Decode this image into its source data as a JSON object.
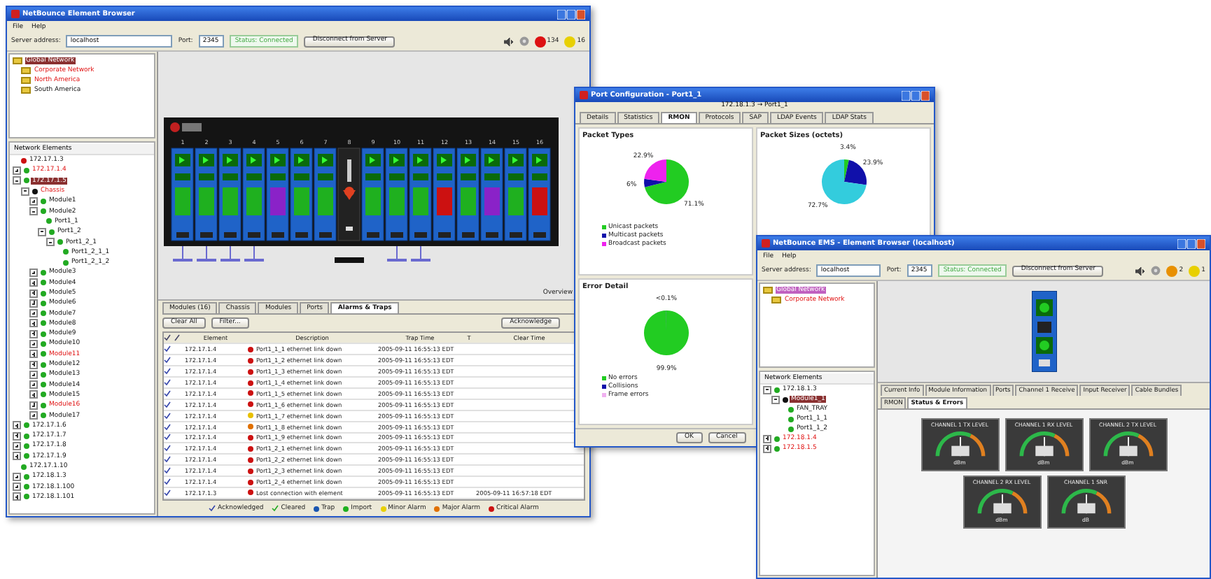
{
  "main_window": {
    "title": "NetBounce Element Browser",
    "menu": [
      "File",
      "Help"
    ],
    "server": {
      "label": "Server address:",
      "value": "localhost"
    },
    "port": {
      "label": "Port:",
      "value": "2345"
    },
    "status": "Status: Connected",
    "disconnect_button": "Disconnect from Server",
    "alarm_badges": [
      {
        "count": "134",
        "color": "#dd1111"
      },
      {
        "count": "16",
        "color": "#e8d000"
      }
    ],
    "network_tree": [
      {
        "label": "Global Network",
        "selected": true,
        "alarm": false
      },
      {
        "label": "Corporate Network",
        "selected": false,
        "alarm": true
      },
      {
        "label": "North America",
        "selected": false,
        "alarm": true
      },
      {
        "label": "South America",
        "selected": false,
        "alarm": false
      }
    ],
    "element_tree_title": "Network Elements",
    "element_tree": [
      {
        "label": "172.17.1.3",
        "color": "#cc1111",
        "alarm": false,
        "selected": false
      },
      {
        "label": "172.17.1.4",
        "color": "#22aa22",
        "alarm": true,
        "selected": false,
        "expanded": false
      },
      {
        "label": "172.17.1.5",
        "color": "#22aa22",
        "alarm": false,
        "selected": true,
        "expanded": true,
        "children": [
          {
            "label": "Chassis",
            "color": "#111111",
            "alarm": true,
            "selected": false,
            "expanded": true,
            "children": [
              {
                "label": "Module1",
                "color": "#22aa22",
                "alarm": false,
                "selected": false,
                "expanded": false
              },
              {
                "label": "Module2",
                "color": "#22aa22",
                "alarm": false,
                "selected": false,
                "expanded": true,
                "children": [
                  {
                    "label": "Port1_1",
                    "color": "#22aa22",
                    "alarm": false,
                    "selected": false
                  },
                  {
                    "label": "Port1_2",
                    "color": "#22aa22",
                    "alarm": false,
                    "selected": false,
                    "expanded": true,
                    "children": [
                      {
                        "label": "Port1_2_1",
                        "color": "#22aa22",
                        "alarm": false,
                        "selected": false,
                        "expanded": true,
                        "children": [
                          {
                            "label": "Port1_2_1_1",
                            "color": "#22aa22",
                            "alarm": false,
                            "selected": false
                          },
                          {
                            "label": "Port1_2_1_2",
                            "color": "#22aa22",
                            "alarm": false,
                            "selected": false
                          }
                        ]
                      }
                    ]
                  }
                ]
              },
              {
                "label": "Module3",
                "color": "#22aa22",
                "alarm": false,
                "selected": false,
                "expanded": false
              },
              {
                "label": "Module4",
                "color": "#22aa22",
                "alarm": false,
                "selected": false,
                "expanded": false
              },
              {
                "label": "Module5",
                "color": "#22aa22",
                "alarm": false,
                "selected": false,
                "expanded": false
              },
              {
                "label": "Module6",
                "color": "#22aa22",
                "alarm": false,
                "selected": false,
                "expanded": false
              },
              {
                "label": "Module7",
                "color": "#22aa22",
                "alarm": false,
                "selected": false,
                "expanded": false
              },
              {
                "label": "Module8",
                "color": "#22aa22",
                "alarm": false,
                "selected": false,
                "expanded": false
              },
              {
                "label": "Module9",
                "color": "#22aa22",
                "alarm": false,
                "selected": false,
                "expanded": false
              },
              {
                "label": "Module10",
                "color": "#22aa22",
                "alarm": false,
                "selected": false,
                "expanded": false
              },
              {
                "label": "Module11",
                "color": "#22aa22",
                "alarm": true,
                "selected": false,
                "expanded": false
              },
              {
                "label": "Module12",
                "color": "#22aa22",
                "alarm": false,
                "selected": false,
                "expanded": false
              },
              {
                "label": "Module13",
                "color": "#22aa22",
                "alarm": false,
                "selected": false,
                "expanded": false
              },
              {
                "label": "Module14",
                "color": "#22aa22",
                "alarm": false,
                "selected": false,
                "expanded": false
              },
              {
                "label": "Module15",
                "color": "#22aa22",
                "alarm": false,
                "selected": false,
                "expanded": false
              },
              {
                "label": "Module16",
                "color": "#22aa22",
                "alarm": true,
                "selected": false,
                "expanded": false
              },
              {
                "label": "Module17",
                "color": "#22aa22",
                "alarm": false,
                "selected": false,
                "expanded": false
              }
            ]
          }
        ]
      },
      {
        "label": "172.17.1.6",
        "color": "#22aa22",
        "alarm": false,
        "selected": false,
        "expanded": false
      },
      {
        "label": "172.17.1.7",
        "color": "#22aa22",
        "alarm": false,
        "selected": false,
        "expanded": false
      },
      {
        "label": "172.17.1.8",
        "color": "#22aa22",
        "alarm": false,
        "selected": false,
        "expanded": false
      },
      {
        "label": "172.17.1.9",
        "color": "#22aa22",
        "alarm": false,
        "selected": false,
        "expanded": false
      },
      {
        "label": "172.17.1.10",
        "color": "#22aa22",
        "alarm": false,
        "selected": false
      },
      {
        "label": "172.18.1.3",
        "color": "#22aa22",
        "alarm": false,
        "selected": false,
        "expanded": false
      },
      {
        "label": "172.18.1.100",
        "color": "#22aa22",
        "alarm": false,
        "selected": false,
        "expanded": false
      },
      {
        "label": "172.18.1.101",
        "color": "#22aa22",
        "alarm": false,
        "selected": false,
        "expanded": false
      }
    ],
    "chassis_slots": [
      {
        "number": "1",
        "kind": "module",
        "color": "#1fb01f"
      },
      {
        "number": "2",
        "kind": "module",
        "color": "#1fb01f"
      },
      {
        "number": "3",
        "kind": "module",
        "color": "#1fb01f"
      },
      {
        "number": "4",
        "kind": "module",
        "color": "#1fb01f"
      },
      {
        "number": "5",
        "kind": "module",
        "color": "#8a22c8"
      },
      {
        "number": "6",
        "kind": "module",
        "color": "#1fb01f"
      },
      {
        "number": "7",
        "kind": "module",
        "color": "#1fb01f"
      },
      {
        "number": "8",
        "kind": "controller"
      },
      {
        "number": "9",
        "kind": "module",
        "color": "#1fb01f"
      },
      {
        "number": "10",
        "kind": "module",
        "color": "#1fb01f"
      },
      {
        "number": "11",
        "kind": "module",
        "color": "#1fb01f"
      },
      {
        "number": "12",
        "kind": "module",
        "color": "#cc1111"
      },
      {
        "number": "13",
        "kind": "module",
        "color": "#1fb01f"
      },
      {
        "number": "14",
        "kind": "module",
        "color": "#8a22c8"
      },
      {
        "number": "15",
        "kind": "module",
        "color": "#1fb01f"
      },
      {
        "number": "16",
        "kind": "module",
        "color": "#cc1111"
      }
    ],
    "overview_label": "Overview",
    "bottom_tabs": [
      {
        "label": "Modules (16)",
        "selected": false
      },
      {
        "label": "Chassis",
        "selected": false
      },
      {
        "label": "Modules",
        "selected": false
      },
      {
        "label": "Ports",
        "selected": false
      },
      {
        "label": "Alarms & Traps",
        "selected": true
      }
    ],
    "alarm_buttons": [
      "Clear All",
      "Filter..."
    ],
    "acknowledge_button": "Acknowledge",
    "alarm_columns": [
      "Element",
      "Description",
      "Trap Time",
      "T",
      "Clear Time"
    ],
    "alarm_rows": [
      {
        "acknowledged": true,
        "element": "172.17.1.4",
        "color": "#cc1111",
        "description": "Port1_1_1  ethernet link down",
        "trap_time": "2005-09-11 16:55:13 EDT",
        "clear_time": ""
      },
      {
        "acknowledged": true,
        "element": "172.17.1.4",
        "color": "#cc1111",
        "description": "Port1_1_2  ethernet link down",
        "trap_time": "2005-09-11 16:55:13 EDT",
        "clear_time": ""
      },
      {
        "acknowledged": true,
        "element": "172.17.1.4",
        "color": "#cc1111",
        "description": "Port1_1_3  ethernet link down",
        "trap_time": "2005-09-11 16:55:13 EDT",
        "clear_time": ""
      },
      {
        "acknowledged": true,
        "element": "172.17.1.4",
        "color": "#cc1111",
        "description": "Port1_1_4  ethernet link down",
        "trap_time": "2005-09-11 16:55:13 EDT",
        "clear_time": ""
      },
      {
        "acknowledged": true,
        "element": "172.17.1.4",
        "color": "#cc1111",
        "description": "Port1_1_5  ethernet link down",
        "trap_time": "2005-09-11 16:55:13 EDT",
        "clear_time": ""
      },
      {
        "acknowledged": true,
        "element": "172.17.1.4",
        "color": "#cc1111",
        "description": "Port1_1_6  ethernet link down",
        "trap_time": "2005-09-11 16:55:13 EDT",
        "clear_time": ""
      },
      {
        "acknowledged": true,
        "element": "172.17.1.4",
        "color": "#e8c000",
        "description": "Port1_1_7  ethernet link down",
        "trap_time": "2005-09-11 16:55:13 EDT",
        "clear_time": ""
      },
      {
        "acknowledged": true,
        "element": "172.17.1.4",
        "color": "#e07000",
        "description": "Port1_1_8  ethernet link down",
        "trap_time": "2005-09-11 16:55:13 EDT",
        "clear_time": ""
      },
      {
        "acknowledged": true,
        "element": "172.17.1.4",
        "color": "#cc1111",
        "description": "Port1_1_9  ethernet link down",
        "trap_time": "2005-09-11 16:55:13 EDT",
        "clear_time": ""
      },
      {
        "acknowledged": true,
        "element": "172.17.1.4",
        "color": "#cc1111",
        "description": "Port1_2_1  ethernet link down",
        "trap_time": "2005-09-11 16:55:13 EDT",
        "clear_time": ""
      },
      {
        "acknowledged": true,
        "element": "172.17.1.4",
        "color": "#cc1111",
        "description": "Port1_2_2  ethernet link down",
        "trap_time": "2005-09-11 16:55:13 EDT",
        "clear_time": ""
      },
      {
        "acknowledged": true,
        "element": "172.17.1.4",
        "color": "#cc1111",
        "description": "Port1_2_3  ethernet link down",
        "trap_time": "2005-09-11 16:55:13 EDT",
        "clear_time": ""
      },
      {
        "acknowledged": true,
        "element": "172.17.1.4",
        "color": "#cc1111",
        "description": "Port1_2_4  ethernet link down",
        "trap_time": "2005-09-11 16:55:13 EDT",
        "clear_time": ""
      },
      {
        "acknowledged": true,
        "element": "172.17.1.3",
        "color": "#cc1111",
        "description": "Lost connection with element",
        "trap_time": "2005-09-11 16:55:13 EDT",
        "clear_time": "2005-09-11 16:57:18 EDT"
      }
    ],
    "legend": [
      {
        "label": "Acknowledged",
        "kind": "check"
      },
      {
        "label": "Cleared",
        "kind": "check",
        "color": "#22aa22"
      },
      {
        "label": "Trap",
        "kind": "dot",
        "color": "#1a56b0"
      },
      {
        "label": "Import",
        "kind": "dot",
        "color": "#1fb01f"
      },
      {
        "label": "Minor Alarm",
        "kind": "dot",
        "color": "#e8d000"
      },
      {
        "label": "Major Alarm",
        "kind": "dot",
        "color": "#e07000"
      },
      {
        "label": "Critical Alarm",
        "kind": "dot",
        "color": "#cc1111"
      }
    ]
  },
  "port_dialog": {
    "title": "Port Configuration - Port1_1",
    "subtitle": "172.18.1.3 → Port1_1",
    "tabs": [
      {
        "label": "Details",
        "selected": false
      },
      {
        "label": "Statistics",
        "selected": false
      },
      {
        "label": "RMON",
        "selected": true
      },
      {
        "label": "Protocols",
        "selected": false
      },
      {
        "label": "SAP",
        "selected": false
      },
      {
        "label": "LDAP Events",
        "selected": false
      },
      {
        "label": "LDAP Stats",
        "selected": false
      }
    ],
    "charts": [
      {
        "chart_data": {
          "type": "pie",
          "title": "Packet Types",
          "categories": [
            "Unicast packets",
            "Multicast packets",
            "Broadcast packets"
          ],
          "values": [
            71.1,
            6,
            22.9
          ],
          "colors": [
            "#22cc22",
            "#1010aa",
            "#ee22ee"
          ],
          "value_labels": [
            "71.1%",
            "6%",
            "22.9%"
          ]
        }
      },
      {
        "chart_data": {
          "type": "pie",
          "title": "Packet Sizes (octets)",
          "values": [
            3.4,
            23.9,
            72.7
          ],
          "colors": [
            "#22cc22",
            "#1010aa",
            "#33ccdd"
          ],
          "value_labels": [
            "3.4%",
            "23.9%",
            "72.7%"
          ]
        }
      },
      {
        "chart_data": {
          "type": "pie",
          "title": "Error Detail",
          "categories": [
            "No errors",
            "Collisions",
            "Frame errors"
          ],
          "values": [
            99.9,
            0.1,
            0
          ],
          "colors": [
            "#22cc22",
            "#1010aa",
            "#f0b0f0"
          ],
          "value_labels": [
            "99.9%",
            "<0.1%",
            null
          ]
        }
      }
    ],
    "buttons": [
      "OK",
      "Cancel"
    ]
  },
  "module_window": {
    "title": "NetBounce EMS - Element Browser (localhost)",
    "menu": [
      "File",
      "Help"
    ],
    "server": {
      "label": "Server address:",
      "value": "localhost"
    },
    "port": {
      "label": "Port:",
      "value": "2345"
    },
    "status": "Status: Connected",
    "disconnect_button": "Disconnect from Server",
    "alarm_badges": [
      {
        "count": "2",
        "color": "#e89000"
      },
      {
        "count": "1",
        "color": "#e8d000"
      }
    ],
    "network_tree": [
      {
        "label": "Global Network",
        "selected": true,
        "alarm": false
      },
      {
        "label": "Corporate Network",
        "selected": false,
        "alarm": true
      }
    ],
    "element_tree_title": "Network Elements",
    "element_tree": [
      {
        "label": "172.18.1.3",
        "color": "#22aa22",
        "alarm": false,
        "selected": false,
        "expanded": true,
        "children": [
          {
            "label": "Module1_1",
            "color": "#111111",
            "alarm": false,
            "selected": true,
            "expanded": true,
            "children": [
              {
                "label": "FAN_TRAY",
                "color": "#22aa22",
                "alarm": false,
                "selected": false
              },
              {
                "label": "Port1_1_1",
                "color": "#22aa22",
                "alarm": false,
                "selected": false
              },
              {
                "label": "Port1_1_2",
                "color": "#22aa22",
                "alarm": false,
                "selected": false
              }
            ]
          }
        ]
      },
      {
        "label": "172.18.1.4",
        "color": "#22aa22",
        "alarm": true,
        "selected": false,
        "expanded": false
      },
      {
        "label": "172.18.1.5",
        "color": "#22aa22",
        "alarm": true,
        "selected": false,
        "expanded": false
      }
    ],
    "tabs": [
      {
        "label": "Current Info",
        "selected": false
      },
      {
        "label": "Module Information",
        "selected": false
      },
      {
        "label": "Ports",
        "selected": false
      },
      {
        "label": "Channel 1 Receive",
        "selected": false
      },
      {
        "label": "Input Receiver",
        "selected": false
      },
      {
        "label": "Cable Bundles",
        "selected": false
      },
      {
        "label": "RMON",
        "selected": false
      },
      {
        "label": "Status & Errors",
        "selected": true
      }
    ],
    "gauges": [
      {
        "title": "CHANNEL 1 TX LEVEL",
        "unit": "dBm"
      },
      {
        "title": "CHANNEL 1 RX LEVEL",
        "unit": "dBm"
      },
      {
        "title": "CHANNEL 2 TX LEVEL",
        "unit": "dBm"
      },
      {
        "title": "CHANNEL 2 RX LEVEL",
        "unit": "dBm"
      },
      {
        "title": "CHANNEL 1 SNR",
        "unit": "dB"
      }
    ]
  }
}
